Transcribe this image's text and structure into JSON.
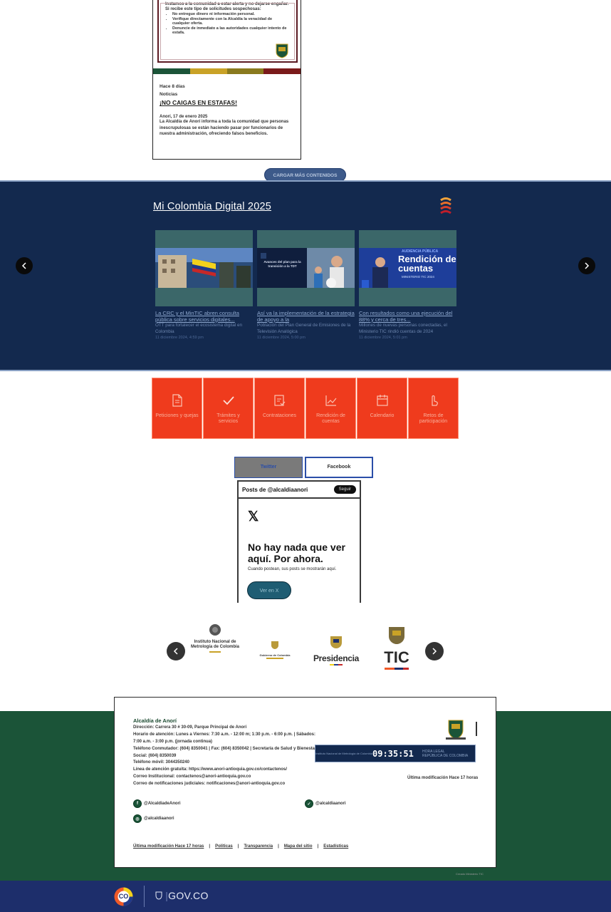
{
  "news": {
    "notice": {
      "intro": "Instamos a la comunidad a estar alerta y no dejarse engañar. Si recibe este tipo de solicitudes sospechosas:",
      "bullets": [
        "No entregue dinero ni información personal.",
        "Verifique directamente con la Alcaldía la veracidad de cualquier oferta.",
        "Denuncie de inmediato a las autoridades cualquier intento de estafa."
      ]
    },
    "time_ago": "Hace 8 días",
    "category": "Noticias",
    "title": "¡NO CAIGAS EN ESTAFAS!",
    "date_line": "Anorí, 17 de enero 2025",
    "summary": "La Alcaldía de Anorí informa a toda la comunidad que personas inescrupulosas se están haciendo pasar por funcionarios de nuestra administración, ofreciendo falsos beneficios.",
    "load_more": "CARGAR MÁS CONTENIDOS"
  },
  "mi_colombia": {
    "title": "Mi Colombia Digital 2025",
    "cards": [
      {
        "caption": "La CRC y el MinTIC abren consulta pública sobre servicios digitales...",
        "subtitle": "OTT para fortalecer el ecosistema digital en Colombia",
        "date": "11 diciembre 2024, 4:59 pm"
      },
      {
        "caption": "Así va la implementación de la estrategia de apoyo a la",
        "subtitle": "Población del Plan General de Emisiones de la Televisión Analógica",
        "date": "11 diciembre 2024, 5:00 pm",
        "image_text": "Avances del plan para la transición a la TDT"
      },
      {
        "caption": "Con resultados como una ejecución del 88% y cerca de tres...",
        "subtitle": "Millones de nuevas personas conectadas, el Ministerio TIC rindió cuentas de 2024",
        "date": "11 diciembre 2024, 5:01 pm",
        "image_text_small": "AUDIENCIA PÚBLICA",
        "image_text_big": "Rendición de cuentas",
        "image_text_tag": "MINISTERIO TIC 2024"
      }
    ]
  },
  "services": [
    {
      "label": "Peticiones y quejas",
      "icon": "document-icon"
    },
    {
      "label": "Trámites y servicios",
      "icon": "check-icon"
    },
    {
      "label": "Contrataciones",
      "icon": "clipboard-check-icon"
    },
    {
      "label": "Rendición de cuentas",
      "icon": "chart-icon"
    },
    {
      "label": "Calendario",
      "icon": "calendar-icon"
    },
    {
      "label": "Retos de participación",
      "icon": "hand-icon"
    }
  ],
  "social": {
    "tab_twitter": "Twitter",
    "tab_facebook": "Facebook",
    "posts_header": "Posts de @alcaldiaanori",
    "follow": "Seguir",
    "empty_title": "No hay nada que ver aquí. Por ahora.",
    "empty_sub": "Cuando postean, sus posts se mostrarán aquí.",
    "view_on_x": "Ver en X"
  },
  "partners": {
    "inm": "Instituto Nacional de Metrología de Colombia",
    "gobierno": "Gobierno de Colombia",
    "presidencia": "Presidencia",
    "tic": "TIC"
  },
  "footer": {
    "name": "Alcaldía de Anorí",
    "lines": [
      "Dirección: Carrera 30 # 30-09, Parque Principal de Anorí",
      "Horario de atención: Lunes a Viernes: 7:30 a.m. - 12:00 m; 1:30 p.m. - 6:00 p.m. | Sábados:",
      "7:00 a.m. - 3:00 p.m. (jornada continua)",
      "Teléfono Conmutador: (604) 8350041 | Fax: (604) 8350042 | Secretaría de Salud y Bienestar",
      "Social: (604) 8350039",
      "Teléfono móvil: 3044350240",
      "Línea de atención gratuita: https://www.anori-antioquia.gov.co/contactenos/",
      "Correo Institucional: contactenos@anori-antioquia.gov.co",
      "Correo de notificaciones judiciales: notificaciones@anori-antioquia.gov.co"
    ],
    "clock": {
      "source": "Instituto Nacional de Metrología de Colombia",
      "time": "09:35:51",
      "legal_1": "HORA LEGAL",
      "legal_2": "REPÚBLICA DE COLOMBIA"
    },
    "last_mod_right": "Última modificación Hace 17 horas",
    "facebook": "@AlcaldiadeAnori",
    "twitter": "@alcaldiaanori",
    "instagram": "@alcaldiaanori",
    "last_mod": "Última modificación Hace 17 horas",
    "links": [
      "Políticas",
      "Transparencia",
      "Mapa del sitio",
      "Estadísticas"
    ],
    "credit": "Creado Ministerio TIC"
  },
  "govbar": {
    "text": "GOV.CO",
    "co": "CO"
  },
  "colors": {
    "navy": "#13294e",
    "orange": "#ef3b1d",
    "green": "#1b5438",
    "govbar": "#1d2e6b"
  }
}
